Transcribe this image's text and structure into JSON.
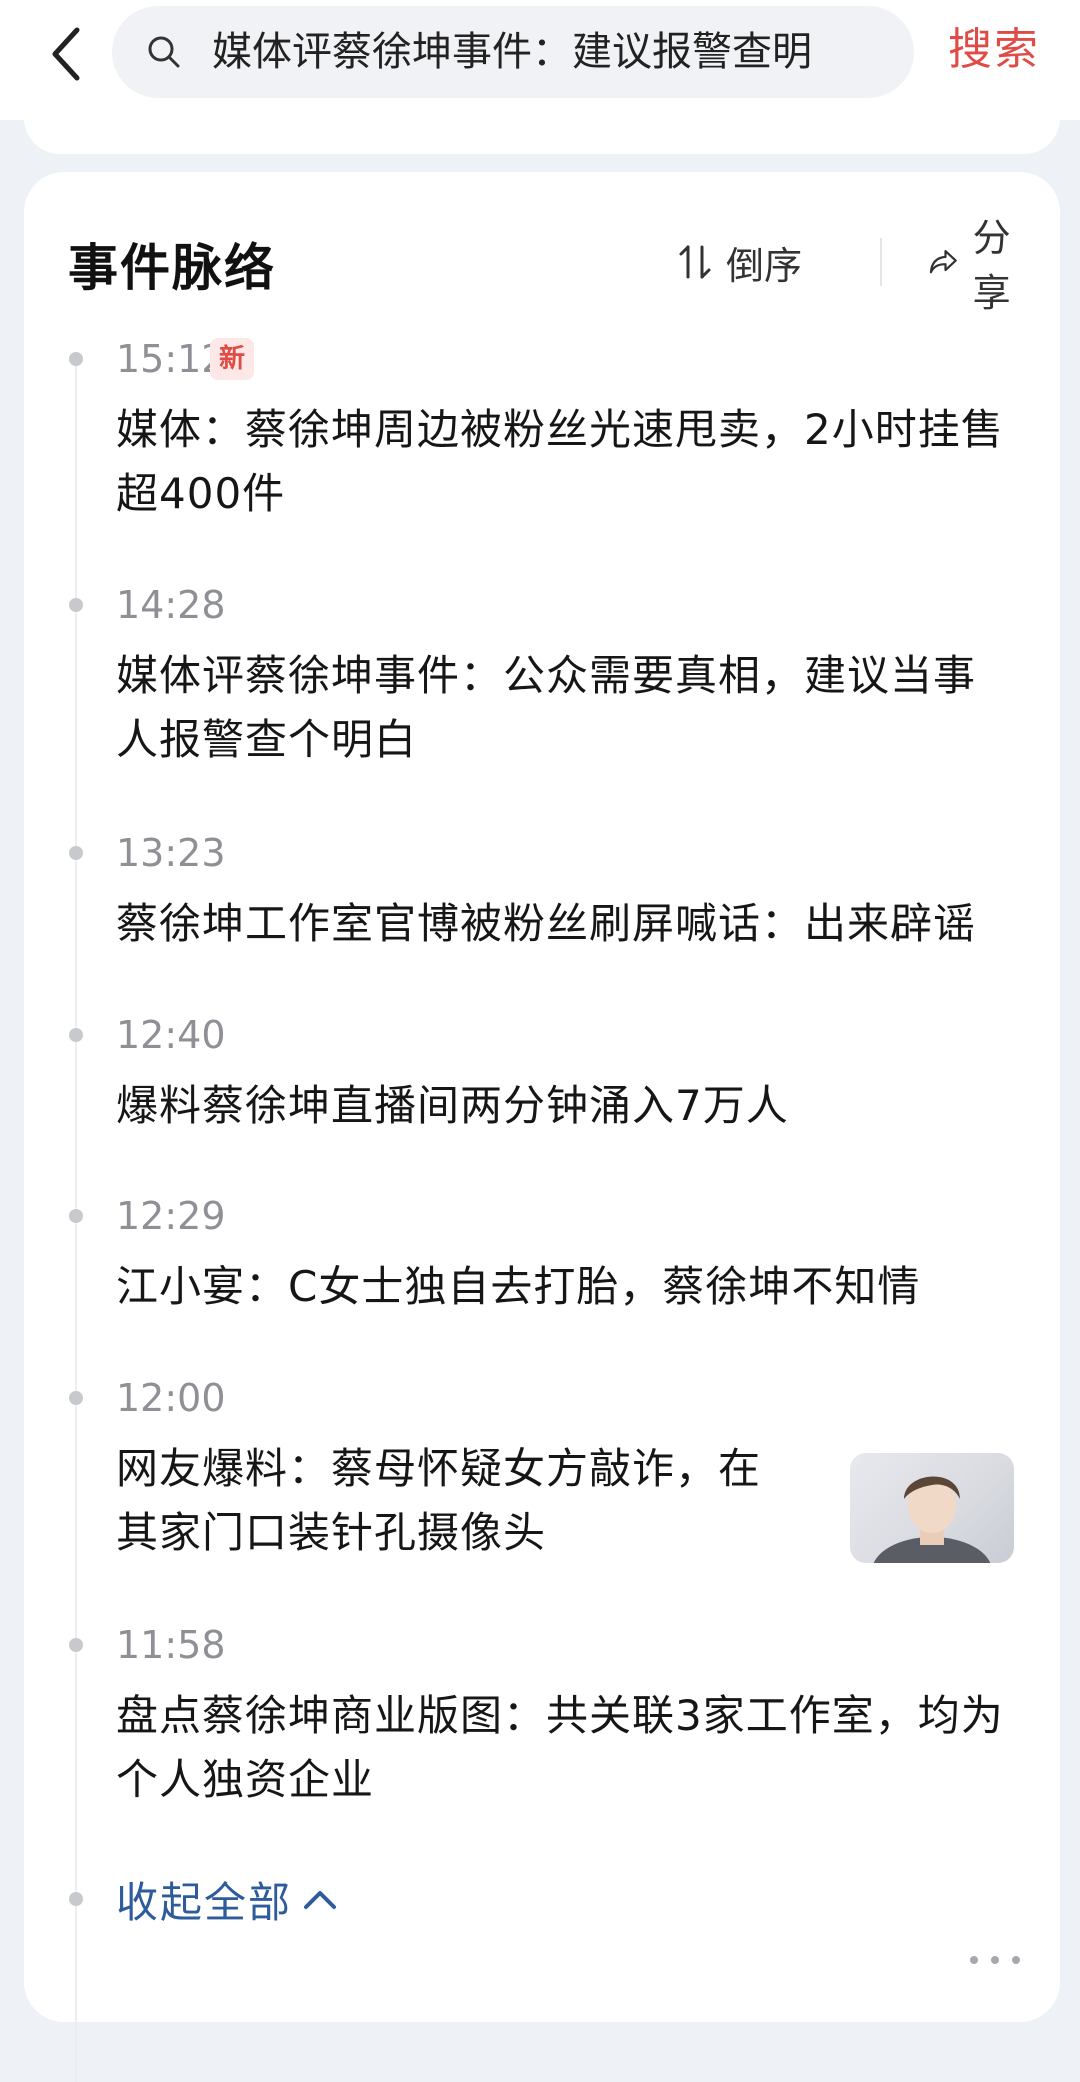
{
  "search": {
    "query": "媒体评蔡徐坤事件：建议报警查明",
    "submit_label": "搜索"
  },
  "card": {
    "title": "事件脉络",
    "sort_label": "倒序",
    "share_label": "分享",
    "collapse_label": "收起全部"
  },
  "events": [
    {
      "time": "15:12",
      "badge": "新",
      "text": "媒体：蔡徐坤周边被粉丝光速甩卖，2小时挂售超400件"
    },
    {
      "time": "14:28",
      "text": "媒体评蔡徐坤事件：公众需要真相，建议当事人报警查个明白"
    },
    {
      "time": "13:23",
      "text": "蔡徐坤工作室官博被粉丝刷屏喊话：出来辟谣"
    },
    {
      "time": "12:40",
      "text": "爆料蔡徐坤直播间两分钟涌入7万人"
    },
    {
      "time": "12:29",
      "text": "江小宴：C女士独自去打胎，蔡徐坤不知情"
    },
    {
      "time": "12:00",
      "text": "网友爆料：蔡母怀疑女方敲诈，在其家门口装针孔摄像头"
    },
    {
      "time": "11:58",
      "text": "盘点蔡徐坤商业版图：共关联3家工作室，均为个人独资企业"
    }
  ],
  "colors": {
    "accent_red": "#e04b45",
    "link_blue": "#2e5b9c",
    "time_gray": "#8e9095"
  },
  "icons": [
    "back-arrow-icon",
    "search-icon",
    "clear-icon",
    "sort-icon",
    "share-icon",
    "chevron-up-icon",
    "more-icon"
  ]
}
